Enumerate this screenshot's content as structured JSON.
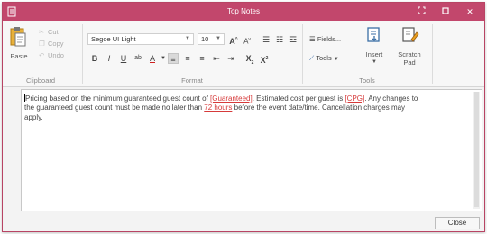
{
  "window": {
    "title": "Top Notes",
    "accent_color": "#c2476c",
    "controls": {
      "restore_icon": "restore-icon",
      "maximize_icon": "maximize-icon",
      "close_icon": "close-icon",
      "close_glyph": "✕",
      "max_glyph": "□",
      "restore_glyph": "⛶"
    }
  },
  "ribbon": {
    "clipboard": {
      "label": "Clipboard",
      "paste_label": "Paste",
      "cut_label": "Cut",
      "copy_label": "Copy",
      "undo_label": "Undo"
    },
    "format": {
      "label": "Format",
      "font_name": "Segoe UI Light",
      "font_size": "10",
      "bold": "B",
      "italic": "I",
      "underline": "U",
      "strike": "ab",
      "font_color": "A",
      "grow": "A",
      "shrink": "A",
      "superscript_x": "X",
      "subscript_x": "X"
    },
    "tools": {
      "label": "Tools",
      "fields_label": "Fields...",
      "tools_label": "Tools",
      "insert_label": "Insert",
      "scratch_label": "Scratch",
      "pad_label": "Pad"
    }
  },
  "editor": {
    "line1_a": "Pricing based on the minimum guaranteed guest count of ",
    "field_guaranteed": "[Guaranteed]",
    "line1_b": ".  Estimated cost per guest is ",
    "field_cpg": "[CPG]",
    "line1_c": ".  Any changes to",
    "line2_a": "the guaranteed guest count must be made no later than ",
    "field_hours": "72 hours",
    "line2_b": " before the event date/time.  Cancellation charges may",
    "line3": "apply.",
    "field_color": "#d63a3a"
  },
  "footer": {
    "close_label": "Close"
  }
}
